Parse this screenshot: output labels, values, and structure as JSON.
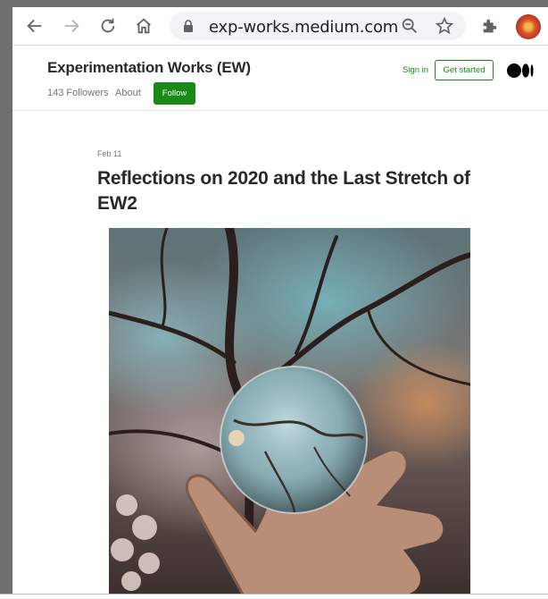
{
  "browser": {
    "url": "exp-works.medium.com",
    "icons": [
      "back-arrow-icon",
      "forward-arrow-icon",
      "reload-icon",
      "home-icon",
      "lock-icon",
      "zoom-icon",
      "star-icon",
      "extensions-puzzle-icon",
      "profile-avatar"
    ]
  },
  "publication": {
    "title": "Experimentation Works (EW)",
    "followers": "143 Followers",
    "about": "About",
    "follow": "Follow",
    "sign_in": "Sign in",
    "get_started": "Get started",
    "accent_color": "#1a8917"
  },
  "post": {
    "date": "Feb 11",
    "title": "Reflections on 2020 and the Last Stretch of EW2"
  }
}
